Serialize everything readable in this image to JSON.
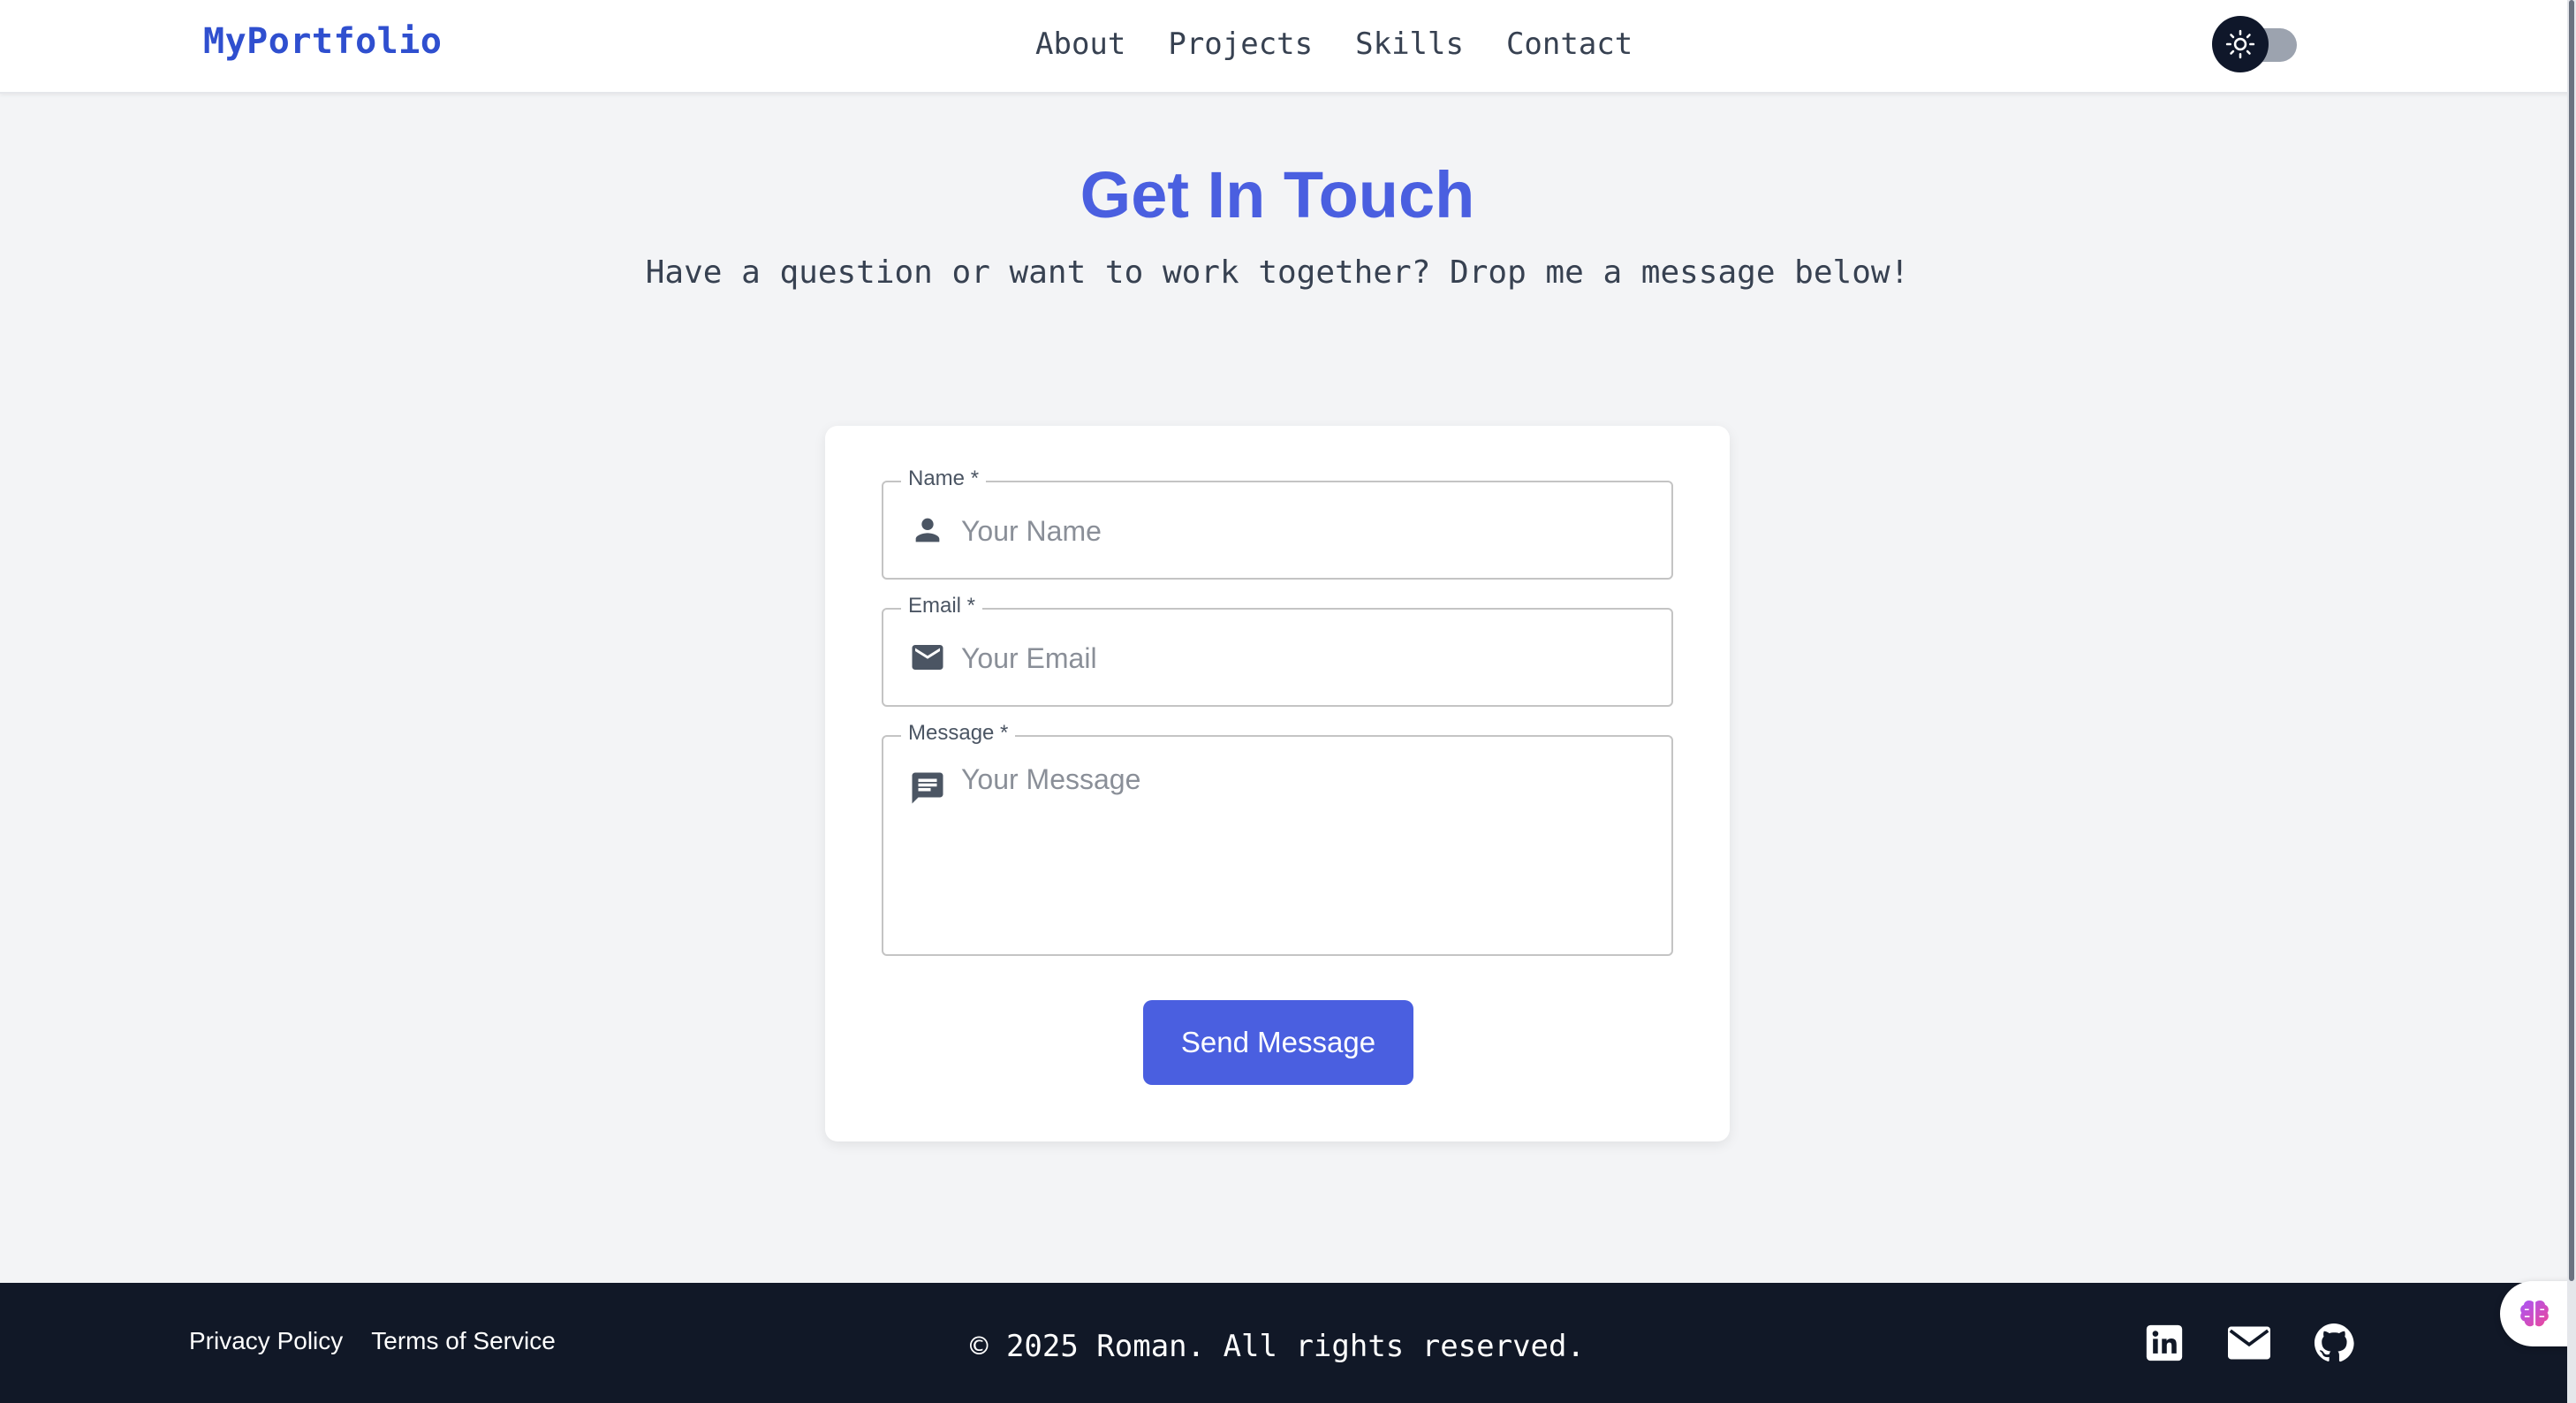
{
  "header": {
    "brand": "MyPortfolio",
    "nav": [
      "About",
      "Projects",
      "Skills",
      "Contact"
    ],
    "theme_toggle": {
      "icon": "sun-icon",
      "state": "light"
    }
  },
  "hero": {
    "title": "Get In Touch",
    "subtitle": "Have a question or want to work together? Drop me a message below!"
  },
  "form": {
    "name": {
      "label": "Name *",
      "placeholder": "Your Name",
      "icon": "person-icon"
    },
    "email": {
      "label": "Email *",
      "placeholder": "Your Email",
      "icon": "mail-icon"
    },
    "message": {
      "label": "Message *",
      "placeholder": "Your Message",
      "icon": "message-icon"
    },
    "submit_label": "Send Message"
  },
  "footer": {
    "links": [
      "Privacy Policy",
      "Terms of Service"
    ],
    "copyright": "© 2025 Roman. All rights reserved.",
    "socials": [
      "linkedin-icon",
      "email-icon",
      "github-icon"
    ]
  },
  "colors": {
    "accent": "#4a5fe0",
    "brand": "#2f4fcf",
    "footer_bg": "#111827",
    "page_bg": "#f3f4f6"
  }
}
